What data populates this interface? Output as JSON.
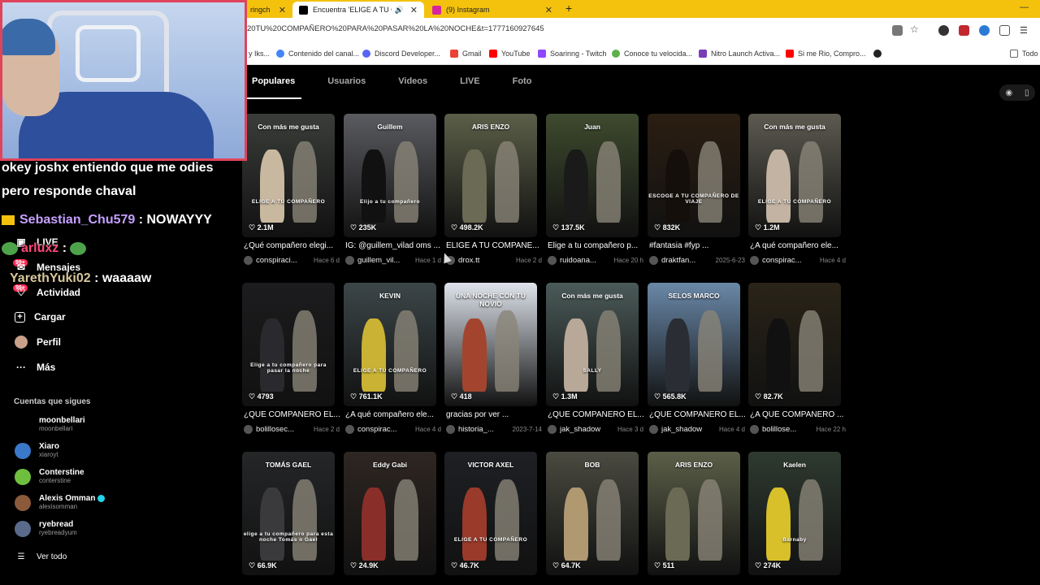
{
  "browser": {
    "tabs": [
      {
        "label": "ringch",
        "favicon_color": "#9146ff"
      },
      {
        "label": "Encuentra 'ELIGE A TU COM",
        "favicon_color": "#000000"
      },
      {
        "label": "(9) Instagram",
        "favicon_color": "#d6249f"
      }
    ],
    "new_tab": "+",
    "url": "20TU%20COMPAÑERO%20PARA%20PASAR%20LA%20NOCHE&t=1777160927645",
    "bookmarks": [
      {
        "label": "y Iks...",
        "color": "#888888"
      },
      {
        "label": "Contenido del canal...",
        "color": "#4285f4"
      },
      {
        "label": "Discord Developer...",
        "color": "#5865f2"
      },
      {
        "label": "Gmail",
        "color": "#ea4335"
      },
      {
        "label": "YouTube",
        "color": "#ff0000"
      },
      {
        "label": "Soarinng - Twitch",
        "color": "#9146ff"
      },
      {
        "label": "Conoce tu velocida...",
        "color": "#5fb04b"
      },
      {
        "label": "Nitro Launch Activa...",
        "color": "#7a3db8"
      },
      {
        "label": "Si me Rio, Compro...",
        "color": "#ff0000"
      },
      {
        "label": "",
        "color": "#222222"
      },
      {
        "label": "Todo",
        "color": "#888888"
      }
    ]
  },
  "search_tabs": [
    "Populares",
    "Usuarios",
    "Videos",
    "LIVE",
    "Foto"
  ],
  "sidebar": {
    "items": [
      {
        "label": "LIVE",
        "icon": "live-icon"
      },
      {
        "label": "Mensajes",
        "icon": "message-icon",
        "badge": "99+"
      },
      {
        "label": "Actividad",
        "icon": "activity-icon",
        "badge": "99+"
      },
      {
        "label": "Cargar",
        "icon": "upload-icon"
      },
      {
        "label": "Perfil",
        "icon": "profile-icon"
      },
      {
        "label": "Más",
        "icon": "more-icon"
      }
    ],
    "following_title": "Cuentas que sigues",
    "following": [
      {
        "name": "moonbellari",
        "handle": "moonbellari",
        "color": "#333333"
      },
      {
        "name": "Xiaro",
        "handle": "xiaroyt",
        "color": "#3a79c9"
      },
      {
        "name": "Conterstine",
        "handle": "conterstine",
        "color": "#6fbf3f"
      },
      {
        "name": "Alexis Omman",
        "handle": "alexisomman",
        "color": "#8a5a3a",
        "verified": true
      },
      {
        "name": "ryebread",
        "handle": "ryebreadyum",
        "color": "#5a6a8a"
      }
    ],
    "see_all": "Ver todo"
  },
  "chat": [
    {
      "user": "",
      "text": "okey joshx entiendo que me odies"
    },
    {
      "user": "",
      "text": "pero responde chaval"
    },
    {
      "user": "Sebastian_Chu579",
      "text": " : NOWAYYY"
    },
    {
      "user": "arluxz",
      "text": " :"
    },
    {
      "user": "YarethYuki02",
      "text": " : waaaaw"
    }
  ],
  "videos": [
    {
      "top": "Con más me gusta",
      "mid": "ELIGE A TU COMPAÑERO",
      "likes": "2.1M",
      "caption": "¿Qué compañero elegi...",
      "author": "conspiraci...",
      "time": "Hace 6 d",
      "bg": "#3a3d3a",
      "fig": "#c9b8a0"
    },
    {
      "top": "Guillem",
      "mid": "Elijo a tu compañero",
      "likes": "235K",
      "caption": "IG: @guillem_vilad oms ...",
      "author": "guillem_vil...",
      "time": "Hace 1 d",
      "bg": "#5a5b60",
      "fig": "#111111"
    },
    {
      "top": "ARIS  ENZO",
      "mid": "",
      "likes": "498.2K",
      "caption": "ELIGE A TU COMPAÑE...",
      "author": "drox.tt",
      "time": "Hace 2 d",
      "bg": "#5b5f48",
      "fig": "#6b6a55"
    },
    {
      "top": "Juan",
      "mid": "",
      "likes": "137.5K",
      "caption": "Elige a tu compañero p...",
      "author": "ruidoana...",
      "time": "Hace 20 h",
      "bg": "#3e4a2e",
      "fig": "#1a1a1a"
    },
    {
      "top": "",
      "mid": "ESCOGE A TU COMPAÑERO DE VIAJE",
      "likes": "832K",
      "caption": "#fantasia #fyp ...",
      "author": "draktfan...",
      "time": "2025-6-23",
      "bg": "#2b1e12",
      "fig": "#140f0a"
    },
    {
      "top": "Con más me gusta",
      "mid": "ELIGE A TU COMPAÑERO",
      "likes": "1.2M",
      "caption": "¿A qué compañero ele...",
      "author": "conspirac...",
      "time": "Hace 4 d",
      "bg": "#5c5a50",
      "fig": "#c2b3a2"
    },
    {
      "top": "",
      "mid": "Elige a tu compañero para pasar la noche",
      "likes": "4793",
      "caption": "¿QUE COMPAÑERO EL...",
      "author": "bolillosec...",
      "time": "Hace 2 d",
      "bg": "#1c1c1e",
      "fig": "#2a2a2e"
    },
    {
      "top": "KEVIN",
      "mid": "ELIGE A TU COMPAÑERO",
      "likes": "761.1K",
      "caption": "¿A qué compañero ele...",
      "author": "conspirac...",
      "time": "Hace 4 d",
      "bg": "#3c4648",
      "fig": "#c9b234"
    },
    {
      "top": "UNA NOCHE CON TU NOVIO",
      "mid": "",
      "likes": "418",
      "caption": "gracias por ver ...",
      "author": "historia_...",
      "time": "2023-7-14",
      "bg": "#dfe4ec",
      "fig": "#a3452e"
    },
    {
      "top": "Con más me gusta",
      "mid": "SALLY",
      "likes": "1.3M",
      "caption": "¿QUE COMPAÑERO EL...",
      "author": "jak_shadow",
      "time": "Hace 3 d",
      "bg": "#4a5a58",
      "fig": "#b8a898"
    },
    {
      "top": "SELOS  MARCO",
      "mid": "",
      "likes": "565.8K",
      "caption": "¿QUE COMPAÑERO EL...",
      "author": "jak_shadow",
      "time": "Hace 4 d",
      "bg": "#6a88a8",
      "fig": "#2a2e34"
    },
    {
      "top": "",
      "mid": "",
      "likes": "82.7K",
      "caption": "¿A QUÉ COMPAÑERO ...",
      "author": "bolillose...",
      "time": "Hace 22 h",
      "bg": "#2a2418",
      "fig": "#111111"
    },
    {
      "top": "TOMÁS  GAEL",
      "mid": "elige a tu compañero para esta noche Tomás o Gael",
      "likes": "66.9K",
      "caption": "",
      "author": "",
      "time": "",
      "bg": "#252628",
      "fig": "#3a3a3c"
    },
    {
      "top": "Eddy  Gabi",
      "mid": "",
      "likes": "24.9K",
      "caption": "",
      "author": "",
      "time": "",
      "bg": "#2e2622",
      "fig": "#8a2e2a"
    },
    {
      "top": "VICTOR  AXEL",
      "mid": "ELIGE A TU COMPAÑERO",
      "likes": "46.7K",
      "caption": "",
      "author": "",
      "time": "",
      "bg": "#1e2024",
      "fig": "#9a3a2a"
    },
    {
      "top": "BOB",
      "mid": "",
      "likes": "64.7K",
      "caption": "",
      "author": "",
      "time": "",
      "bg": "#4a4a40",
      "fig": "#b09870"
    },
    {
      "top": "ARIS  ENZO",
      "mid": "",
      "likes": "511",
      "caption": "",
      "author": "",
      "time": "",
      "bg": "#5b5f48",
      "fig": "#6b6a55"
    },
    {
      "top": "Kaelen",
      "mid": "Barnaby",
      "likes": "274K",
      "caption": "",
      "author": "",
      "time": "",
      "bg": "#2e3a30",
      "fig": "#d8c02a"
    }
  ]
}
